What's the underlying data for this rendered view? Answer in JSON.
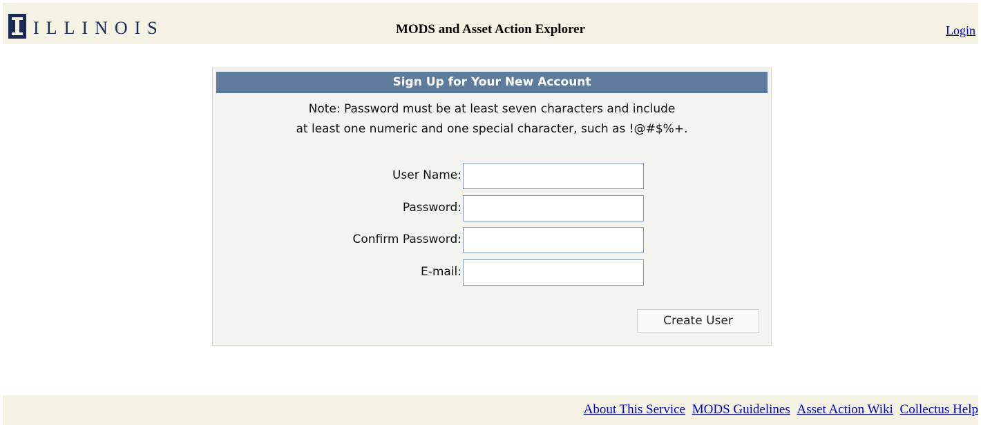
{
  "header": {
    "logo_text": "ILLINOIS",
    "title": "MODS and Asset Action Explorer",
    "login_label": "Login"
  },
  "signup": {
    "title": "Sign Up for Your New Account",
    "note_line1": "Note: Password must be at least seven characters and include",
    "note_line2": "at least one numeric and one special character, such as !@#$%+.",
    "fields": [
      {
        "label": "User Name:",
        "value": "",
        "type": "text"
      },
      {
        "label": "Password:",
        "value": "",
        "type": "password"
      },
      {
        "label": "Confirm Password:",
        "value": "",
        "type": "password"
      },
      {
        "label": "E-mail:",
        "value": "",
        "type": "text"
      }
    ],
    "submit_label": "Create User"
  },
  "footer": {
    "links": [
      "About This Service",
      "MODS Guidelines",
      "Asset Action Wiki",
      "Collectus Help"
    ]
  },
  "colors": {
    "header_bg": "#f4f2e2",
    "panel_title_bg": "#5d7b9c",
    "link": "#0000cc",
    "brand_navy": "#1b2b55"
  }
}
